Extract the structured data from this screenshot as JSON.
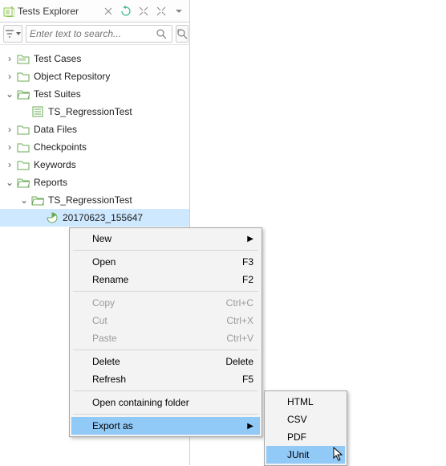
{
  "titlebar": {
    "title": "Tests Explorer"
  },
  "search": {
    "placeholder": "Enter text to search..."
  },
  "tree": {
    "nodes": [
      {
        "label": "Test Cases"
      },
      {
        "label": "Object Repository"
      },
      {
        "label": "Test Suites"
      },
      {
        "label": "TS_RegressionTest"
      },
      {
        "label": "Data Files"
      },
      {
        "label": "Checkpoints"
      },
      {
        "label": "Keywords"
      },
      {
        "label": "Reports"
      },
      {
        "label": "TS_RegressionTest"
      },
      {
        "label": "20170623_155647"
      }
    ]
  },
  "contextmenu": {
    "new": "New",
    "open": "Open",
    "open_sc": "F3",
    "rename": "Rename",
    "rename_sc": "F2",
    "copy": "Copy",
    "copy_sc": "Ctrl+C",
    "cut": "Cut",
    "cut_sc": "Ctrl+X",
    "paste": "Paste",
    "paste_sc": "Ctrl+V",
    "delete": "Delete",
    "delete_sc": "Delete",
    "refresh": "Refresh",
    "refresh_sc": "F5",
    "opencontaining": "Open containing folder",
    "exportas": "Export as"
  },
  "submenu": {
    "html": "HTML",
    "csv": "CSV",
    "pdf": "PDF",
    "junit": "JUnit"
  }
}
